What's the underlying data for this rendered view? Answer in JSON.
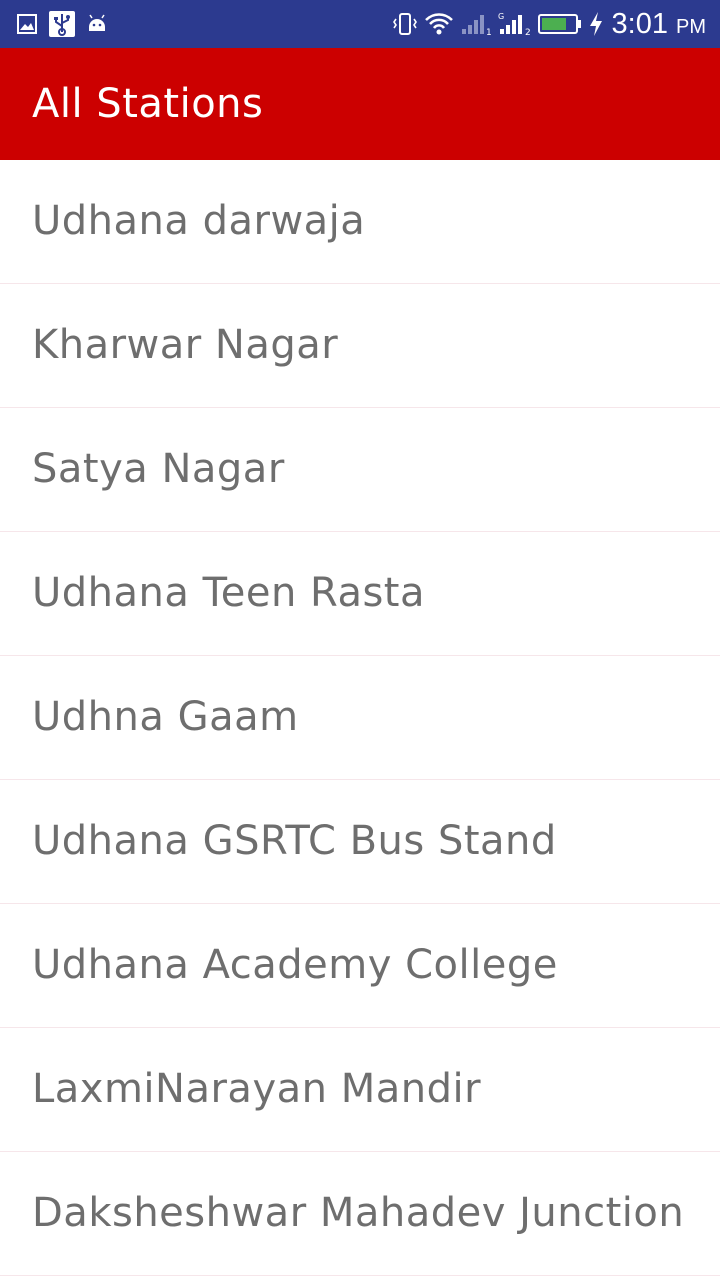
{
  "status_bar": {
    "time": "3:01",
    "ampm": "PM",
    "icons_left": [
      "gallery-icon",
      "usb-icon",
      "android-icon"
    ],
    "icons_right": [
      "vibrate-icon",
      "wifi-icon",
      "signal-sim1-icon",
      "signal-sim2-icon",
      "battery-icon",
      "charging-icon"
    ]
  },
  "app_bar": {
    "title": "All Stations",
    "color": "#cc0000"
  },
  "stations": [
    {
      "name": "Udhana darwaja"
    },
    {
      "name": "Kharwar Nagar"
    },
    {
      "name": "Satya Nagar"
    },
    {
      "name": "Udhana Teen Rasta"
    },
    {
      "name": "Udhna Gaam"
    },
    {
      "name": "Udhana GSRTC Bus Stand"
    },
    {
      "name": "Udhana Academy College"
    },
    {
      "name": "LaxmiNarayan Mandir"
    },
    {
      "name": "Daksheshwar Mahadev Junction"
    }
  ]
}
